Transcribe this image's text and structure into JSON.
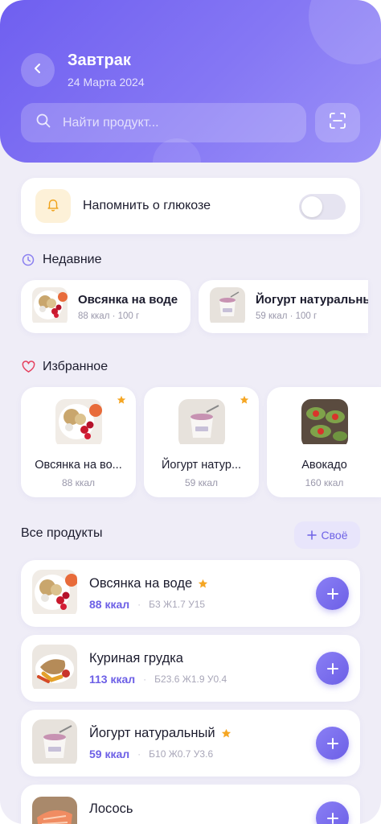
{
  "header": {
    "title": "Завтрак",
    "date": "24 Марта 2024",
    "search_placeholder": "Найти продукт..."
  },
  "reminder": {
    "label": "Напомнить о глюкозе",
    "enabled": false
  },
  "recent": {
    "title": "Недавние",
    "items": [
      {
        "name": "Овсянка на воде",
        "sub": "88 ккал · 100 г"
      },
      {
        "name": "Йогурт натуральный",
        "sub": "59 ккал · 100 г"
      }
    ]
  },
  "favorites": {
    "title": "Избранное",
    "items": [
      {
        "name": "Овсянка на во...",
        "kcal": "88 ккал",
        "starred": true
      },
      {
        "name": "Йогурт натур...",
        "kcal": "59 ккал",
        "starred": true
      },
      {
        "name": "Авокадо",
        "kcal": "160 ккал",
        "starred": false
      }
    ]
  },
  "all_products": {
    "title": "Все продукты",
    "own_button": "Своё",
    "items": [
      {
        "name": "Овсянка на воде",
        "kcal": "88 ккал",
        "macros": "Б3 Ж1.7 У15",
        "starred": true
      },
      {
        "name": "Куриная грудка",
        "kcal": "113 ккал",
        "macros": "Б23.6 Ж1.9 У0.4",
        "starred": false
      },
      {
        "name": "Йогурт натуральный",
        "kcal": "59 ккал",
        "macros": "Б10 Ж0.7 У3.6",
        "starred": true
      },
      {
        "name": "Лосось",
        "kcal": "",
        "macros": "",
        "starred": false
      }
    ]
  },
  "colors": {
    "accent": "#6c5fe6",
    "header_gradient_start": "#6f5ff0",
    "header_gradient_end": "#9c92f8",
    "star": "#f5a623",
    "heart": "#e5415f",
    "background": "#efedf7"
  },
  "icons": {
    "back": "chevron-left-icon",
    "search": "search-icon",
    "scan": "scan-icon",
    "bell": "bell-icon",
    "clock": "clock-icon",
    "heart": "heart-icon",
    "star": "star-icon",
    "plus": "plus-icon"
  }
}
